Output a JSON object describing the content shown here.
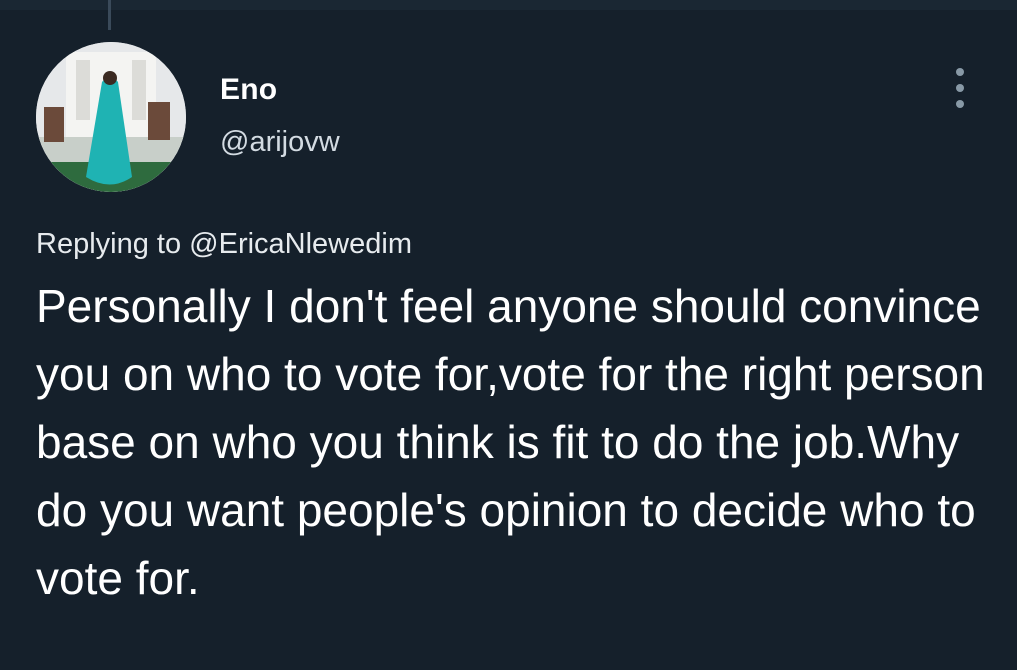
{
  "tweet": {
    "author": {
      "name": "Eno",
      "handle": "@arijovw",
      "avatar_icon": "profile-photo"
    },
    "reply": {
      "prefix": "Replying to ",
      "to": "@EricaNlewedim"
    },
    "text": "Personally I don't feel anyone should convince you on who to vote for,vote for the right person base on who you think is fit to do the job.Why do you want people's opinion to decide who to vote for.",
    "more_icon": "more-options-icon"
  },
  "colors": {
    "background": "#15202b",
    "text": "#ffffff",
    "secondary": "#d3dbe2",
    "icon": "#8899a6"
  }
}
